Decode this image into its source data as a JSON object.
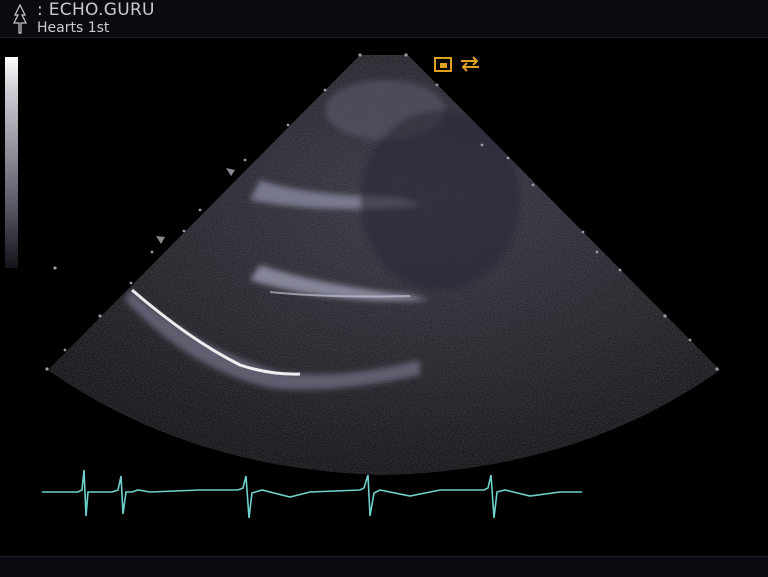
{
  "header": {
    "site_name": ": ECHO.GURU",
    "subtitle": "Hearts 1st"
  },
  "viewer": {
    "mode": "2D echocardiogram",
    "view": "parasternal long axis",
    "accent_color": "#e0a020",
    "ecg_color": "#6fd1cc",
    "icons": [
      "tree-logo-icon",
      "probe-orientation-icon",
      "sector-marker-icon"
    ]
  }
}
